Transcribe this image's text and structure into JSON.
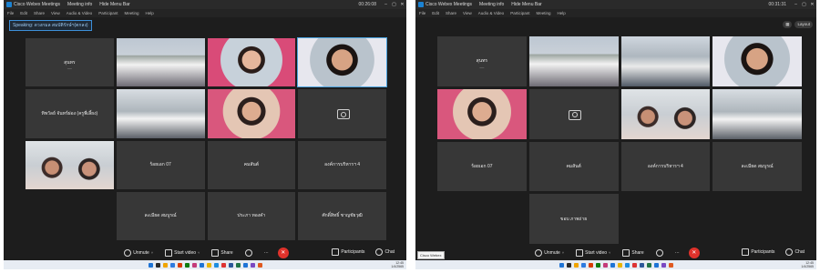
{
  "left": {
    "title_items": [
      "Cisco Webex Meetings",
      "Meeting info",
      "Hide Menu Bar"
    ],
    "clock": "00:26:08",
    "menu": [
      "File",
      "Edit",
      "Share",
      "View",
      "Audio & Video",
      "Participant",
      "Meeting",
      "Help"
    ],
    "view_tag": "Speaking: ดวงกมล สมบัติรักษ์ฯ(ตกลง)",
    "tiles": [
      {
        "type": "name",
        "name": "สุนทร",
        "sub": "—"
      },
      {
        "type": "video",
        "look": "v-room",
        "name": ""
      },
      {
        "type": "video",
        "look": "v-pink",
        "name": ""
      },
      {
        "type": "video",
        "look": "v-smile",
        "name": "",
        "active": true
      },
      {
        "type": "name",
        "name": "ทิพวัลย์ จันทร์ผ่อง (ครูพี่เลี้ยง)",
        "sub": ""
      },
      {
        "type": "video",
        "look": "v-office",
        "name": ""
      },
      {
        "type": "video",
        "look": "v-pinkwoman",
        "name": ""
      },
      {
        "type": "cam",
        "name": ""
      },
      {
        "type": "video",
        "look": "v-women",
        "name": ""
      },
      {
        "type": "name",
        "name": "ร้อยเอก 07",
        "sub": ""
      },
      {
        "type": "name",
        "name": "คมสันต์",
        "sub": ""
      },
      {
        "type": "name",
        "name": "องค์การบริหารฯ 4",
        "sub": ""
      },
      {
        "type": "blank",
        "name": ""
      },
      {
        "type": "name",
        "name": "ละเมียด สมบูรณ์",
        "sub": ""
      },
      {
        "type": "name",
        "name": "ประภา ทองคำ",
        "sub": ""
      },
      {
        "type": "name",
        "name": "ศักดิ์สิทธิ์ ชาญชัยวุฒิ",
        "sub": ""
      },
      {
        "type": "blank",
        "name": ""
      }
    ],
    "toolbar": {
      "mute": "Unmute",
      "video": "Start video",
      "share": "Share",
      "participants": "Participants",
      "chat": "Chat"
    }
  },
  "right": {
    "title_items": [
      "Cisco Webex Meetings",
      "Meeting info",
      "Hide Menu Bar"
    ],
    "clock": "00:31:31",
    "menu": [
      "File",
      "Edit",
      "Share",
      "View",
      "Audio & Video",
      "Participant",
      "Meeting",
      "Help"
    ],
    "layout_label": "Layout",
    "tiles": [
      {
        "type": "name",
        "name": "สุนทร",
        "sub": "—"
      },
      {
        "type": "video",
        "look": "v-room",
        "name": ""
      },
      {
        "type": "video",
        "look": "v-room2",
        "name": ""
      },
      {
        "type": "video",
        "look": "v-smile",
        "name": ""
      },
      {
        "type": "video",
        "look": "v-pinkwoman",
        "name": ""
      },
      {
        "type": "cam",
        "name": ""
      },
      {
        "type": "video",
        "look": "v-women",
        "name": ""
      },
      {
        "type": "video",
        "look": "v-office",
        "name": ""
      },
      {
        "type": "name",
        "name": "ร้อยเอก 07",
        "sub": ""
      },
      {
        "type": "name",
        "name": "คมสันต์",
        "sub": ""
      },
      {
        "type": "name",
        "name": "องค์การบริหารฯ 4",
        "sub": ""
      },
      {
        "type": "name",
        "name": "ละเมียด สมบูรณ์",
        "sub": ""
      },
      {
        "type": "blank",
        "name": ""
      },
      {
        "type": "name",
        "name": "ขอบ ภาพถ่าย",
        "sub": ""
      },
      {
        "type": "blank",
        "name": ""
      },
      {
        "type": "blank",
        "name": ""
      }
    ],
    "toolbar": {
      "mute": "Unmute",
      "video": "Start video",
      "share": "Share",
      "participants": "Participants",
      "chat": "Chat"
    },
    "status_tip": "Cisco Webex"
  },
  "taskbar_colors": [
    "#1e74d6",
    "#2a2a2a",
    "#f0a400",
    "#2d7be0",
    "#d83b01",
    "#0f7b0f",
    "#c43b7a",
    "#1e74d6",
    "#e8b400",
    "#1e8de0",
    "#dd3333",
    "#2b579a",
    "#217346",
    "#1e74d6",
    "#7a49c2",
    "#e05a20"
  ],
  "taskbar_tray": [
    "12:45",
    "1/4/2565"
  ]
}
